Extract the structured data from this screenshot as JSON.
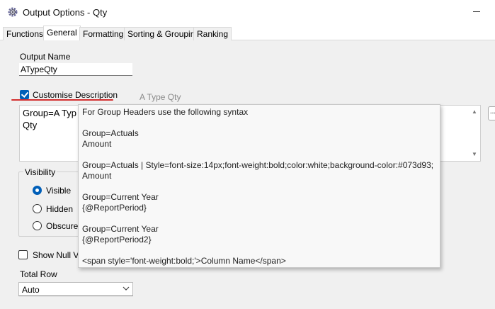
{
  "window": {
    "title": "Output Options - Qty",
    "icon": "gear-icon"
  },
  "tabs": [
    {
      "label": "Functions",
      "active": false
    },
    {
      "label": "General",
      "active": true
    },
    {
      "label": "Formatting",
      "active": false
    },
    {
      "label": "Sorting & Grouping",
      "active": false
    },
    {
      "label": "Ranking",
      "active": false
    }
  ],
  "general": {
    "output_name_label": "Output Name",
    "output_name_value": "ATypeQty",
    "customise_description_label": "Customise Description",
    "customise_description_checked": true,
    "description_preview": "A Type Qty",
    "description_text": "Group=A Typ\nQty",
    "side_button_label": "...",
    "visibility": {
      "title": "Visibility",
      "options": [
        "Visible",
        "Hidden",
        "Obscured"
      ],
      "selected": "Visible"
    },
    "show_null_label": "Show Null Va",
    "show_null_checked": false,
    "total_row_label": "Total Row",
    "total_row_value": "Auto"
  },
  "tooltip": {
    "lines": [
      "For Group Headers use the following syntax",
      "Group=Actuals",
      "Amount",
      "Group=Actuals | Style=font-size:14px;font-weight:bold;color:white;background-color:#073d93;",
      "Amount",
      "Group=Current Year",
      "{@ReportPeriod}",
      "Group=Current Year",
      "{@ReportPeriod2}",
      "<span style='font-weight:bold;'>Column Name</span>"
    ]
  },
  "colors": {
    "accent": "#005fb8",
    "underline": "#d32f2f",
    "panel_bg": "#f0f0f0"
  }
}
